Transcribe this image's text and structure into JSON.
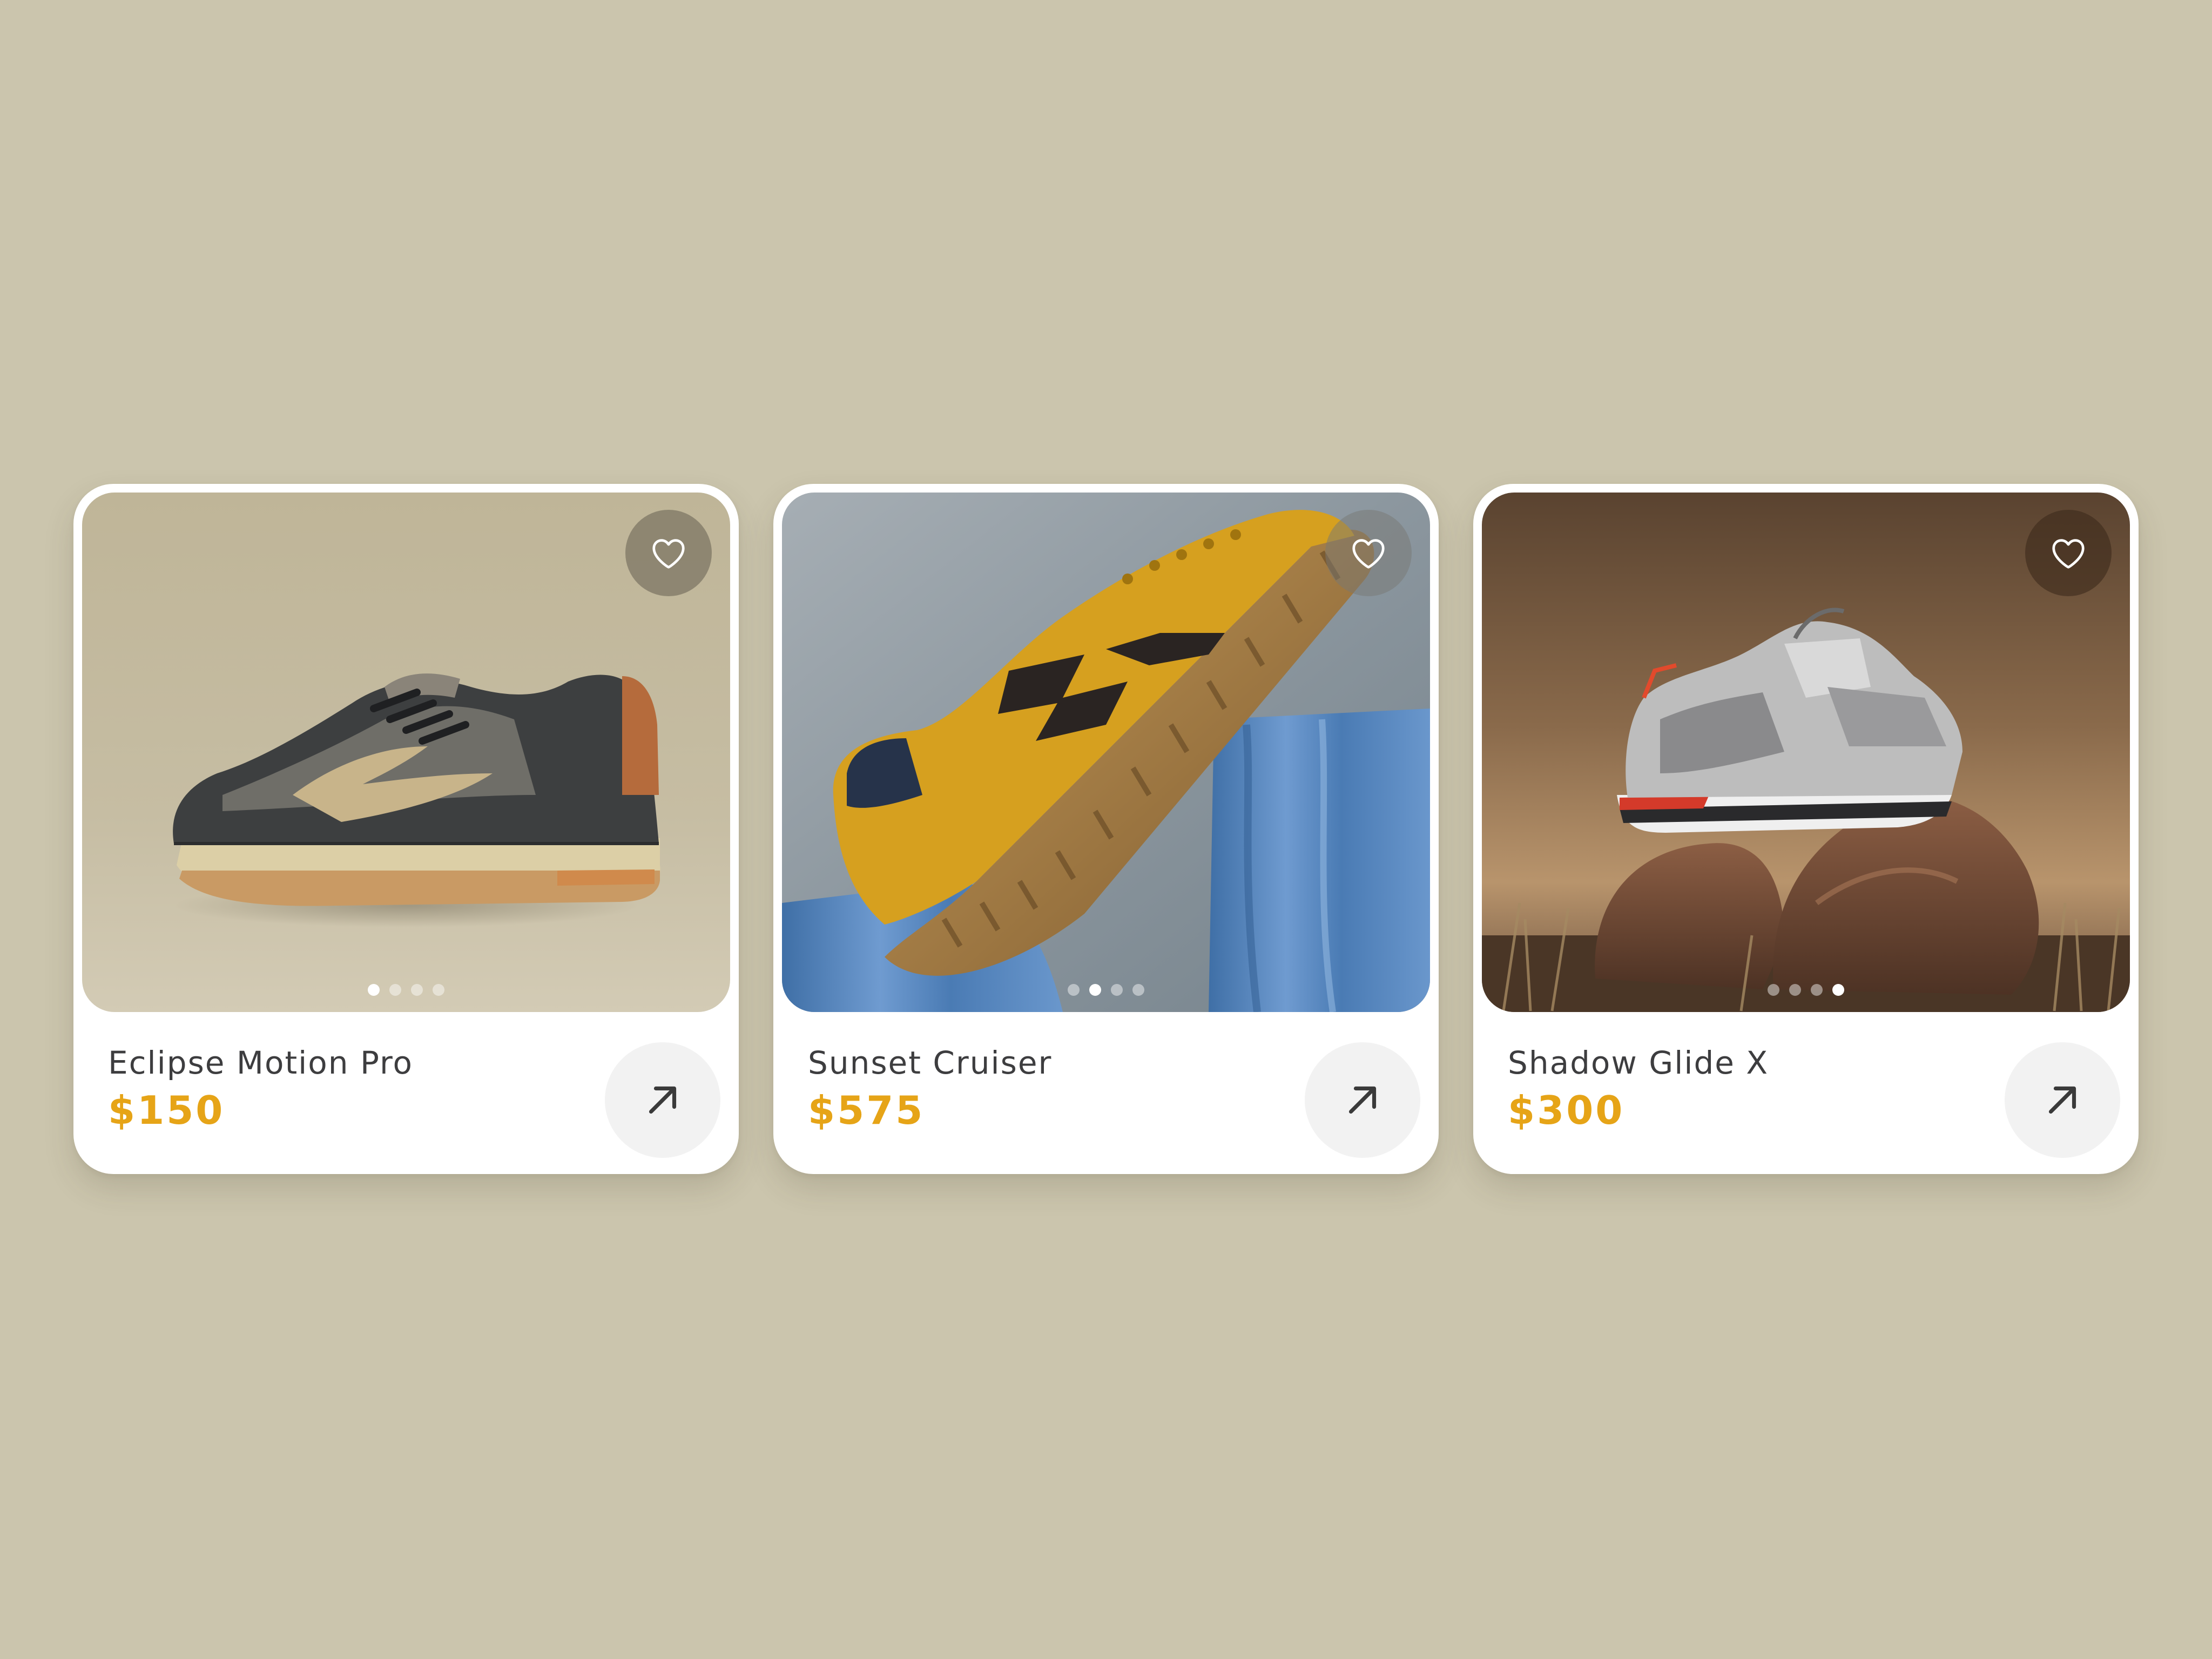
{
  "theme": {
    "background": "#cbc5ad",
    "card_background": "#ffffff",
    "price_color": "#e6a417",
    "name_color": "#3d3d3f"
  },
  "icons": {
    "favorite": "heart-icon",
    "open": "arrow-up-right-icon"
  },
  "products": [
    {
      "name": "Eclipse Motion Pro",
      "price": "$150",
      "image": "grey-and-tan-running-shoe",
      "carousel": {
        "total": 4,
        "active": 1
      }
    },
    {
      "name": "Sunset Cruiser",
      "price": "$575",
      "image": "mustard-suede-sneaker-on-blue-fabric",
      "carousel": {
        "total": 4,
        "active": 2
      }
    },
    {
      "name": "Shadow Glide X",
      "price": "$300",
      "image": "silver-chunky-sneaker-on-rocks",
      "carousel": {
        "total": 4,
        "active": 4
      }
    }
  ]
}
